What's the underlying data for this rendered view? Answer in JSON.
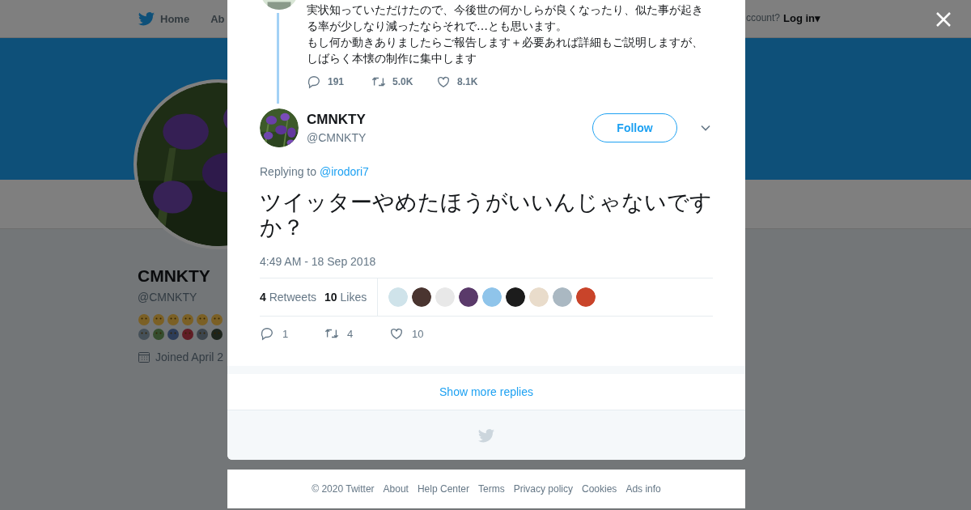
{
  "nav": {
    "items": [
      {
        "label": "Home",
        "selected": false
      },
      {
        "label": "Ab",
        "selected": false
      }
    ],
    "login_prompt": "ccount?",
    "login": "Log in",
    "login_caret": "▾"
  },
  "profile": {
    "name": "CMNKTY",
    "handle": "@CMNKTY",
    "joined": "Joined April 2"
  },
  "modal": {
    "previous_tweet": {
      "lines": [
        "実状知っていただけたので、今後世の何かしらが良くなったり、似た事が起き",
        "る率が少しなり減ったならそれで…とも思います。",
        "もし何か動きありましたらご報告します＋必要あれば詳細もご説明しますが、",
        "しばらく本懐の制作に集中します"
      ],
      "replies": "191",
      "retweets": "5.0K",
      "likes": "8.1K"
    },
    "tweet": {
      "name": "CMNKTY",
      "handle": "@CMNKTY",
      "follow": "Follow",
      "replying_label": "Replying to",
      "replying_to": "@irodori7",
      "text": "ツイッターやめたほうがいいんじゃないですか？",
      "timestamp": "4:49 AM - 18 Sep 2018",
      "retweet_count": "4",
      "retweet_label": "Retweets",
      "like_count": "10",
      "like_label": "Likes",
      "likers": [
        {
          "color": "#cfe3ea"
        },
        {
          "color": "#4a3530"
        },
        {
          "color": "#e8e8e8"
        },
        {
          "color": "#5a3a6a"
        },
        {
          "color": "#8fc4ea"
        },
        {
          "color": "#1c1c1c"
        },
        {
          "color": "#e9dccb"
        },
        {
          "color": "#aab8c2"
        },
        {
          "color": "#c9442a"
        }
      ],
      "replies": "1",
      "retweets": "4",
      "likes": "10"
    },
    "show_more": "Show more replies"
  },
  "footer": [
    "© 2020 Twitter",
    "About",
    "Help Center",
    "Terms",
    "Privacy policy",
    "Cookies",
    "Ads info"
  ]
}
